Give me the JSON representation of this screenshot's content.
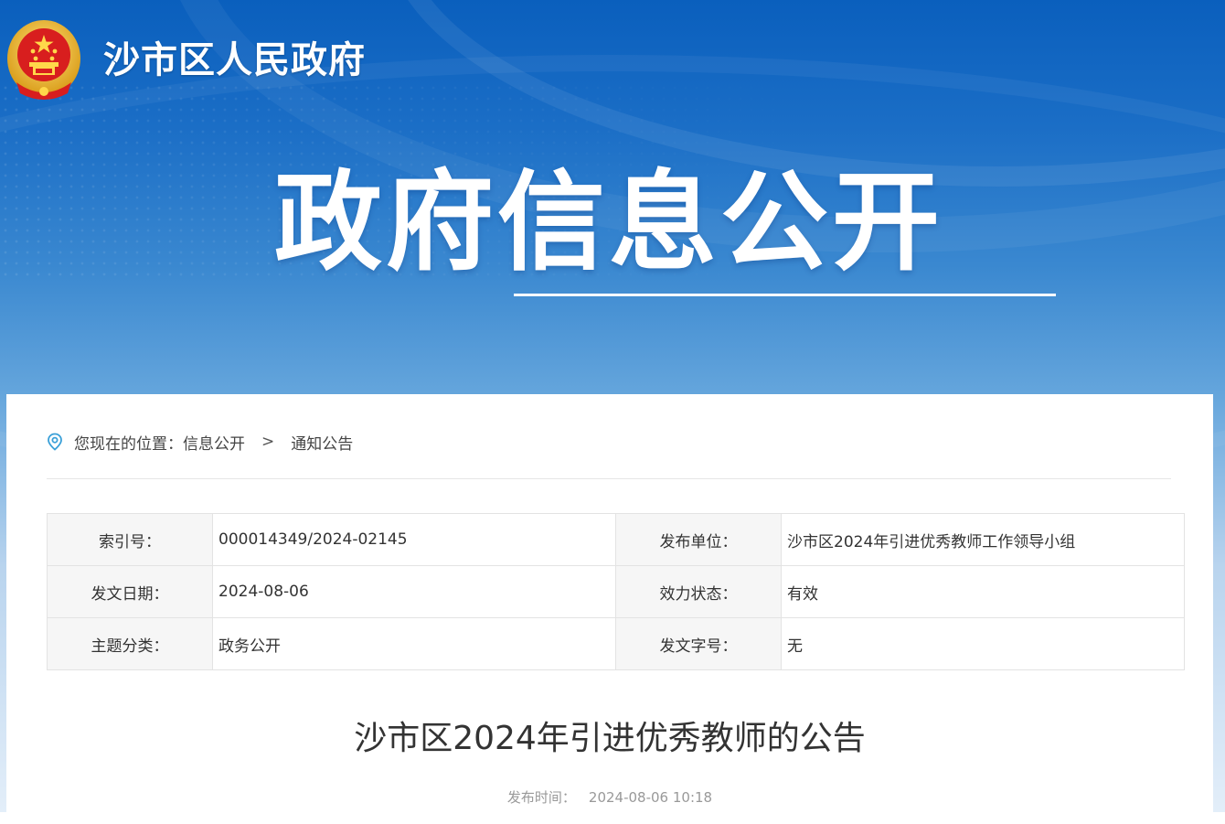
{
  "header": {
    "site_name": "沙市区人民政府",
    "hero_title": "政府信息公开",
    "emblem_icon": "national-emblem-icon",
    "brand_color": "#0a5fbd"
  },
  "breadcrumb": {
    "prefix": "您现在的位置：",
    "items": [
      "信息公开",
      "通知公告"
    ],
    "separator": ">",
    "icon": "location-pin-icon",
    "icon_color": "#3aa0d8"
  },
  "meta": {
    "rows": [
      {
        "left_label": "索引号：",
        "left_value": "000014349/2024-02145",
        "right_label": "发布单位：",
        "right_value": "沙市区2024年引进优秀教师工作领导小组"
      },
      {
        "left_label": "发文日期：",
        "left_value": "2024-08-06",
        "right_label": "效力状态：",
        "right_value": "有效"
      },
      {
        "left_label": "主题分类：",
        "left_value": "政务公开",
        "right_label": "发文字号：",
        "right_value": "无"
      }
    ]
  },
  "article": {
    "title": "沙市区2024年引进优秀教师的公告",
    "publish_label": "发布时间：",
    "publish_time": "2024-08-06 10:18"
  }
}
